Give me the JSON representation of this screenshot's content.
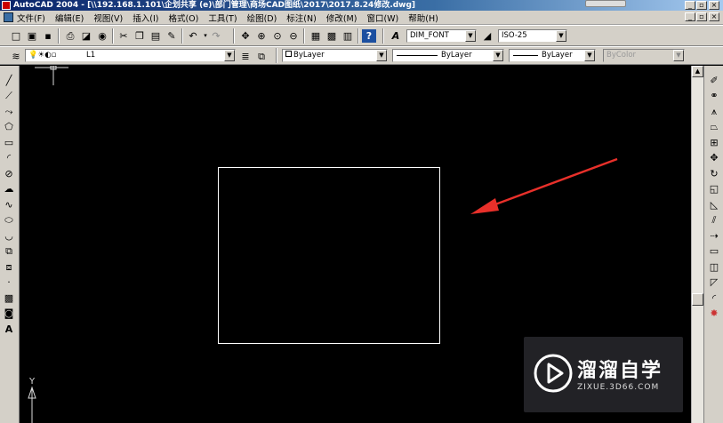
{
  "window": {
    "title": "AutoCAD 2004 - [\\\\192.168.1.101\\企划共享 (e)\\部门管理\\商场CAD图纸\\2017\\2017.8.24修改.dwg]"
  },
  "menu": {
    "items": [
      "文件(F)",
      "编辑(E)",
      "视图(V)",
      "插入(I)",
      "格式(O)",
      "工具(T)",
      "绘图(D)",
      "标注(N)",
      "修改(M)",
      "窗口(W)",
      "帮助(H)"
    ]
  },
  "toolbar": {
    "text_style": "DIM_FONT",
    "dim_style": "ISO-25"
  },
  "properties": {
    "layer": "L1",
    "color": "ByLayer",
    "linetype": "ByLayer",
    "lineweight": "ByLayer",
    "plot_style": "ByColor"
  },
  "ucs": {
    "y_label": "Y"
  },
  "watermark": {
    "name": "溜溜自学",
    "url": "ZIXUE.3D66.COM"
  },
  "colors": {
    "canvas": "#000000",
    "rectangle": "#ffffff",
    "arrow": "#e8302a",
    "chrome": "#d4d0c8"
  }
}
